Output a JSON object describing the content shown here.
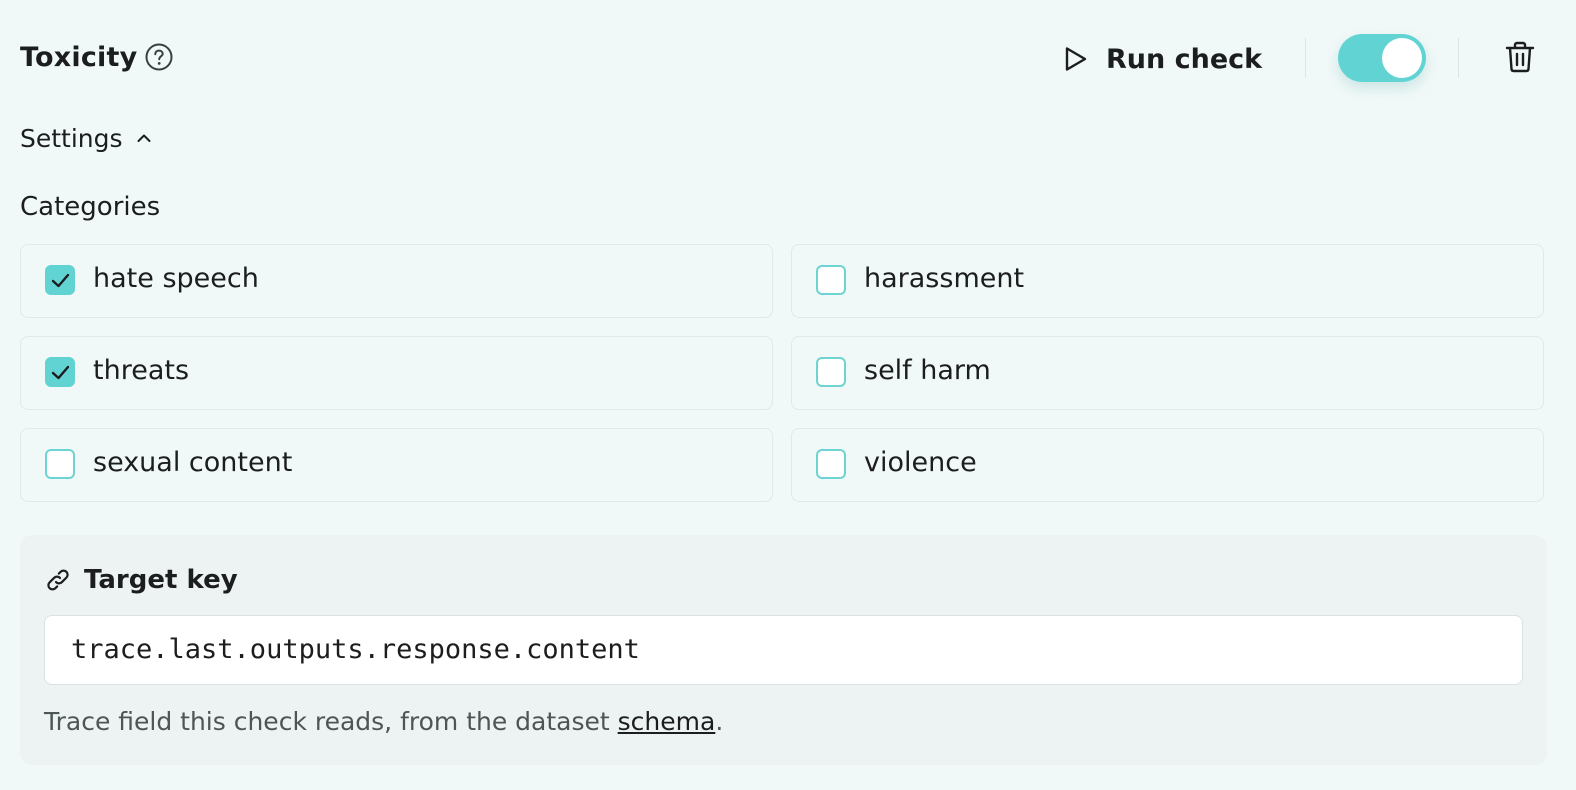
{
  "header": {
    "title": "Toxicity",
    "run_label": "Run check",
    "toggle_on": true,
    "accent_color": "#62d3d3"
  },
  "settings": {
    "label": "Settings",
    "expanded": true
  },
  "categories": {
    "label": "Categories",
    "items": [
      {
        "label": "hate speech",
        "checked": true
      },
      {
        "label": "harassment",
        "checked": false
      },
      {
        "label": "threats",
        "checked": true
      },
      {
        "label": "self harm",
        "checked": false
      },
      {
        "label": "sexual content",
        "checked": false
      },
      {
        "label": "violence",
        "checked": false
      }
    ]
  },
  "target_key": {
    "label": "Target key",
    "value": "trace.last.outputs.response.content",
    "help_prefix": "Trace field this check reads, from the dataset ",
    "help_link": "schema",
    "help_suffix": "."
  },
  "icons": [
    "help-circle-icon",
    "play-icon",
    "trash-icon",
    "chevron-up-icon",
    "link-icon",
    "checkmark-icon"
  ]
}
